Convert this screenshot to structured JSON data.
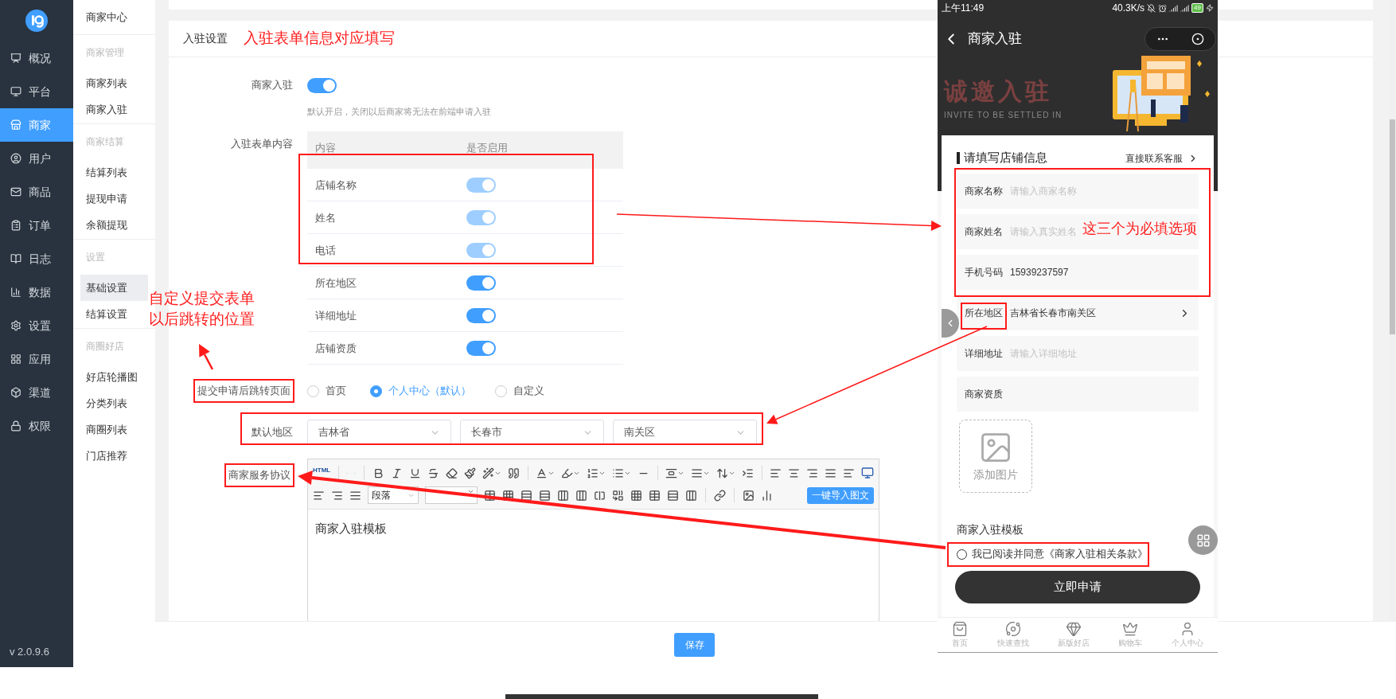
{
  "sidebar": {
    "items": [
      {
        "label": "概况",
        "selected": false
      },
      {
        "label": "平台",
        "selected": false
      },
      {
        "label": "商家",
        "selected": true
      },
      {
        "label": "用户",
        "selected": false
      },
      {
        "label": "商品",
        "selected": false
      },
      {
        "label": "订单",
        "selected": false
      },
      {
        "label": "日志",
        "selected": false
      },
      {
        "label": "数据",
        "selected": false
      },
      {
        "label": "设置",
        "selected": false
      },
      {
        "label": "应用",
        "selected": false
      },
      {
        "label": "渠道",
        "selected": false
      },
      {
        "label": "权限",
        "selected": false
      }
    ],
    "version": "v 2.0.9.6"
  },
  "subnav": {
    "title": "商家中心",
    "groups": [
      {
        "heading": "商家管理",
        "items": [
          {
            "label": "商家列表",
            "selected": false
          },
          {
            "label": "商家入驻",
            "selected": false
          }
        ]
      },
      {
        "heading": "商家结算",
        "items": [
          {
            "label": "结算列表",
            "selected": false
          },
          {
            "label": "提现申请",
            "selected": false
          },
          {
            "label": "余额提现",
            "selected": false
          }
        ]
      },
      {
        "heading": "设置",
        "items": [
          {
            "label": "基础设置",
            "selected": true
          },
          {
            "label": "结算设置",
            "selected": false
          }
        ]
      },
      {
        "heading": "商圈好店",
        "items": [
          {
            "label": "好店轮播图",
            "selected": false
          },
          {
            "label": "分类列表",
            "selected": false
          },
          {
            "label": "商圈列表",
            "selected": false
          },
          {
            "label": "门店推荐",
            "selected": false
          }
        ]
      }
    ]
  },
  "card": {
    "title": "入驻设置"
  },
  "form": {
    "merchant_entry": {
      "label": "商家入驻",
      "on": true,
      "hint": "默认开启，关闭以后商家将无法在前端申请入驻"
    },
    "form_content": {
      "label": "入驻表单内容",
      "columns": [
        "内容",
        "是否启用"
      ],
      "rows": [
        {
          "name": "店铺名称",
          "on": true,
          "disabled": true
        },
        {
          "name": "姓名",
          "on": true,
          "disabled": true
        },
        {
          "name": "电话",
          "on": true,
          "disabled": true
        },
        {
          "name": "所在地区",
          "on": true,
          "disabled": false
        },
        {
          "name": "详细地址",
          "on": true,
          "disabled": false
        },
        {
          "name": "店铺资质",
          "on": true,
          "disabled": false
        }
      ]
    },
    "redirect": {
      "label": "提交申请后跳转页面",
      "options": [
        {
          "label": "首页",
          "selected": false
        },
        {
          "label": "个人中心（默认）",
          "selected": true
        },
        {
          "label": "自定义",
          "selected": false
        }
      ]
    },
    "region": {
      "label": "默认地区",
      "selects": [
        "吉林省",
        "长春市",
        "南关区"
      ]
    },
    "agreement": {
      "label": "商家服务协议",
      "editor": {
        "html_label": "HTML",
        "paragraph_select": "段落",
        "import_button": "一键导入图文",
        "content": "商家入驻模板"
      }
    }
  },
  "save_button": "保存",
  "phone": {
    "status_bar": {
      "time": "上午11:49",
      "speed": "40.3K/s",
      "battery": "49"
    },
    "nav": {
      "title": "商家入驻"
    },
    "banner": {
      "title": "诚邀入驻",
      "subtitle": "INVITE TO BE SETTLED IN"
    },
    "section_title": "请填写店铺信息",
    "contact_link": "直接联系客服",
    "fields": [
      {
        "kind": "input",
        "label": "商家名称",
        "placeholder": "请输入商家名称"
      },
      {
        "kind": "input",
        "label": "商家姓名",
        "placeholder": "请输入真实姓名"
      },
      {
        "kind": "input",
        "label": "手机号码",
        "value": "15939237597"
      },
      {
        "kind": "select",
        "label": "所在地区",
        "value": "吉林省长春市南关区"
      },
      {
        "kind": "input",
        "label": "详细地址",
        "placeholder": "请输入详细地址"
      },
      {
        "kind": "upload",
        "label": "商家资质",
        "upload_label": "添加图片"
      }
    ],
    "template_title": "商家入驻模板",
    "agreement": {
      "text": "我已阅读并同意《商家入驻相关条款》",
      "checked": false
    },
    "submit_button": "立即申请",
    "tabs": [
      {
        "label": "首页",
        "selected": false
      },
      {
        "label": "快速查找",
        "selected": false
      },
      {
        "label": "新版好店",
        "selected": false
      },
      {
        "label": "购物车",
        "selected": false
      },
      {
        "label": "个人中心",
        "selected": false
      }
    ]
  },
  "annotations": [
    {
      "text": "入驻表单信息对应填写"
    },
    {
      "text": "自定义提交表单以后跳转的位置"
    },
    {
      "text": "这三个为必填选项"
    }
  ]
}
